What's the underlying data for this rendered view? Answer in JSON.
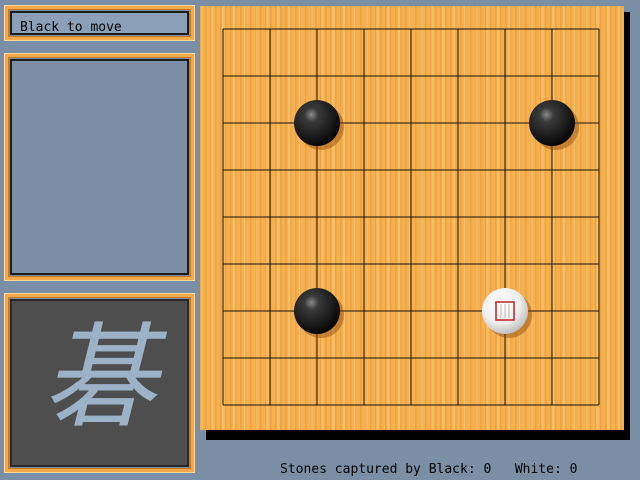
{
  "status": {
    "text": "Black to move"
  },
  "captured": {
    "black_label": "Stones captured by Black:",
    "black_count": "0",
    "white_label": "White:",
    "white_count": "0"
  },
  "board": {
    "size": 9,
    "stones": [
      {
        "color": "black",
        "col": 2,
        "row": 2
      },
      {
        "color": "black",
        "col": 7,
        "row": 2
      },
      {
        "color": "black",
        "col": 2,
        "row": 6
      },
      {
        "color": "white",
        "col": 6,
        "row": 6,
        "last_move": true
      }
    ]
  },
  "logo": {
    "glyph": "碁"
  },
  "colors": {
    "background": "#7a8fa6",
    "frame": "#f5a84a",
    "board": "#f6b04f",
    "logo_bg": "#4e4e4e",
    "logo_glyph": "#9db1c7",
    "last_move_marker": "#c02020"
  }
}
